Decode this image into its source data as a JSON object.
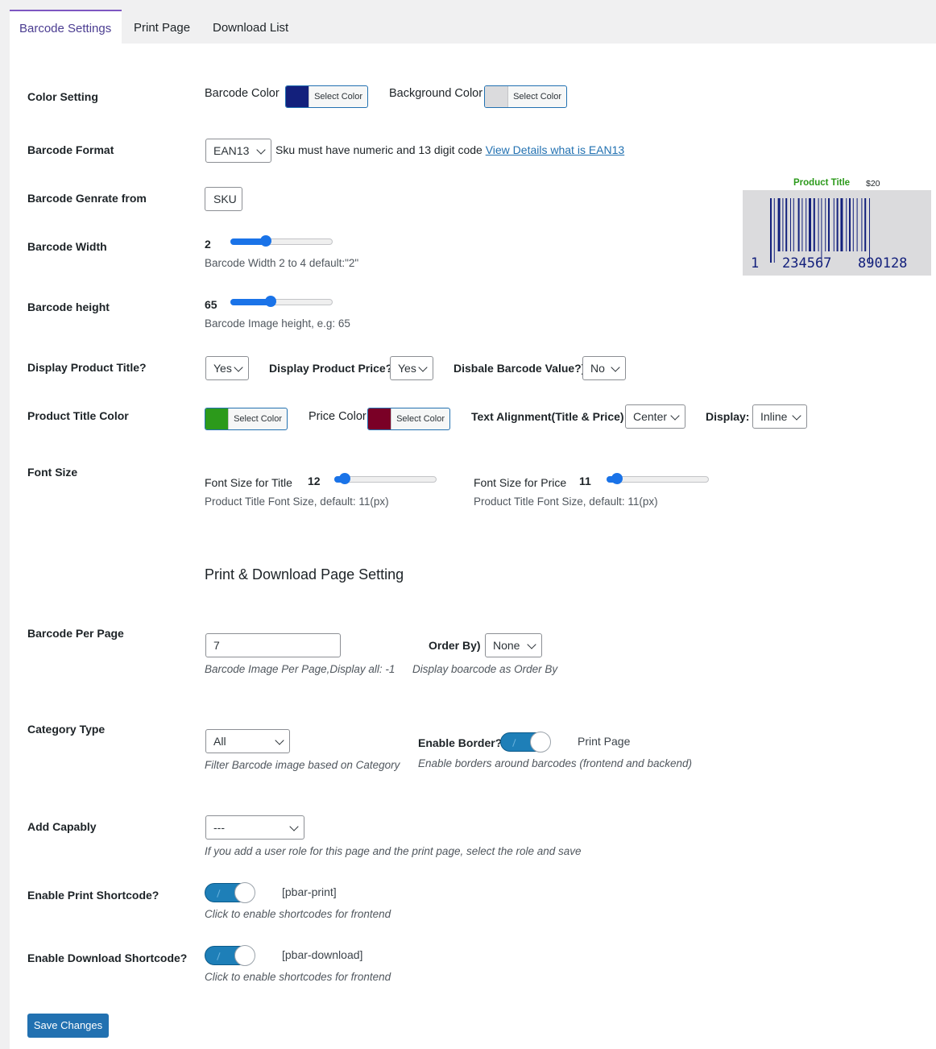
{
  "tabs": [
    {
      "label": "Barcode Settings",
      "active": true
    },
    {
      "label": "Print Page",
      "active": false
    },
    {
      "label": "Download List",
      "active": false
    }
  ],
  "color_setting": {
    "label": "Color Setting",
    "barcode_color_label": "Barcode Color",
    "barcode_color": "#13207c",
    "background_color_label": "Background Color",
    "background_color": "#dbdbdd",
    "select_color_label": "Select Color"
  },
  "barcode_format": {
    "label": "Barcode Format",
    "value": "EAN13",
    "hint": "Sku must have numeric and 13 digit code",
    "link": "View Details what is EAN13"
  },
  "barcode_generate_from": {
    "label": "Barcode Genrate from",
    "value": "SKU"
  },
  "barcode_width": {
    "label": "Barcode Width",
    "value": "2",
    "fraction": 0.35,
    "desc": "Barcode Width 2 to 4 default:\"2\""
  },
  "barcode_height": {
    "label": "Barcode height",
    "value": "65",
    "fraction": 0.39,
    "desc": "Barcode Image height, e.g: 65"
  },
  "display_title": {
    "label": "Display Product Title?",
    "value": "Yes",
    "price_label": "Display Product Price?",
    "price_value": "Yes",
    "disable_value_label": "Disbale Barcode Value?)",
    "disable_value": "No"
  },
  "product_title_color": {
    "label": "Product Title Color",
    "title_color": "#2c9a1b",
    "price_color_label": "Price Color",
    "price_color": "#7a0026",
    "alignment_label": "Text Alignment(Title & Price)",
    "alignment_value": "Center",
    "display_label": "Display:",
    "display_value": "Inline"
  },
  "font_size": {
    "label": "Font Size",
    "title_label": "Font Size for Title",
    "title_value": "12",
    "title_fraction": 0.1,
    "title_desc": "Product Title Font Size, default: 11(px)",
    "price_label": "Font Size for Price",
    "price_value": "11",
    "price_fraction": 0.1,
    "price_desc": "Product Title Font Size, default: 11(px)"
  },
  "print_section_title": "Print & Download Page Setting",
  "barcode_per_page": {
    "label": "Barcode Per Page",
    "value": "7",
    "desc": "Barcode Image Per Page,Display all: -1",
    "order_label": "Order By)",
    "order_value": "None",
    "order_desc": "Display boarcode as Order By"
  },
  "category_type": {
    "label": "Category Type",
    "value": "All",
    "desc": "Filter Barcode image based on Category",
    "border_label": "Enable Border?",
    "border_note": "Print Page",
    "border_desc": "Enable borders around barcodes (frontend and backend)"
  },
  "add_capability": {
    "label": "Add Capably",
    "value": "---",
    "desc": "If you add a user role for this page and the print page, select the role and save"
  },
  "print_shortcode": {
    "label": "Enable Print Shortcode?",
    "code": "[pbar-print]",
    "desc": "Click to enable shortcodes for frontend"
  },
  "download_shortcode": {
    "label": "Enable Download Shortcode?",
    "code": "[pbar-download]",
    "desc": "Click to enable shortcodes for frontend"
  },
  "save_label": "Save Changes",
  "preview": {
    "title": "Product Title",
    "price": "$20",
    "digits": [
      "1",
      "234567",
      "890128"
    ],
    "bar_color": "#13207c"
  }
}
